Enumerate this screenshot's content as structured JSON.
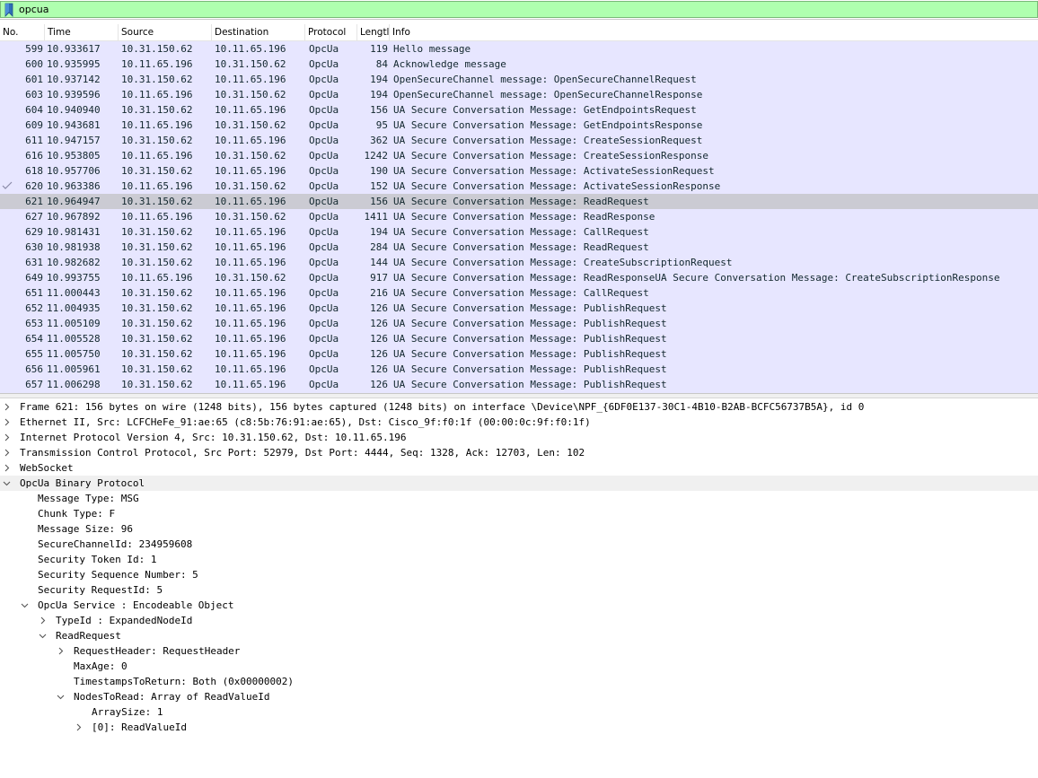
{
  "filter": {
    "value": "opcua",
    "bookmark_icon": "bookmark-icon"
  },
  "columns": {
    "no": "No.",
    "time": "Time",
    "source": "Source",
    "destination": "Destination",
    "protocol": "Protocol",
    "length": "Lengtl",
    "info": "Info"
  },
  "packets": [
    {
      "no": "599",
      "time": "10.933617",
      "source": "10.31.150.62",
      "destination": "10.11.65.196",
      "protocol": "OpcUa",
      "length": "119",
      "info": "Hello message"
    },
    {
      "no": "600",
      "time": "10.935995",
      "source": "10.11.65.196",
      "destination": "10.31.150.62",
      "protocol": "OpcUa",
      "length": "84",
      "info": "Acknowledge message"
    },
    {
      "no": "601",
      "time": "10.937142",
      "source": "10.31.150.62",
      "destination": "10.11.65.196",
      "protocol": "OpcUa",
      "length": "194",
      "info": "OpenSecureChannel message: OpenSecureChannelRequest"
    },
    {
      "no": "603",
      "time": "10.939596",
      "source": "10.11.65.196",
      "destination": "10.31.150.62",
      "protocol": "OpcUa",
      "length": "194",
      "info": "OpenSecureChannel message: OpenSecureChannelResponse"
    },
    {
      "no": "604",
      "time": "10.940940",
      "source": "10.31.150.62",
      "destination": "10.11.65.196",
      "protocol": "OpcUa",
      "length": "156",
      "info": "UA Secure Conversation Message: GetEndpointsRequest"
    },
    {
      "no": "609",
      "time": "10.943681",
      "source": "10.11.65.196",
      "destination": "10.31.150.62",
      "protocol": "OpcUa",
      "length": "95",
      "info": "UA Secure Conversation Message: GetEndpointsResponse"
    },
    {
      "no": "611",
      "time": "10.947157",
      "source": "10.31.150.62",
      "destination": "10.11.65.196",
      "protocol": "OpcUa",
      "length": "362",
      "info": "UA Secure Conversation Message: CreateSessionRequest"
    },
    {
      "no": "616",
      "time": "10.953805",
      "source": "10.11.65.196",
      "destination": "10.31.150.62",
      "protocol": "OpcUa",
      "length": "1242",
      "info": "UA Secure Conversation Message: CreateSessionResponse"
    },
    {
      "no": "618",
      "time": "10.957706",
      "source": "10.31.150.62",
      "destination": "10.11.65.196",
      "protocol": "OpcUa",
      "length": "190",
      "info": "UA Secure Conversation Message: ActivateSessionRequest"
    },
    {
      "no": "620",
      "time": "10.963386",
      "source": "10.11.65.196",
      "destination": "10.31.150.62",
      "protocol": "OpcUa",
      "length": "152",
      "info": "UA Secure Conversation Message: ActivateSessionResponse"
    },
    {
      "no": "621",
      "time": "10.964947",
      "source": "10.31.150.62",
      "destination": "10.11.65.196",
      "protocol": "OpcUa",
      "length": "156",
      "info": "UA Secure Conversation Message: ReadRequest"
    },
    {
      "no": "627",
      "time": "10.967892",
      "source": "10.11.65.196",
      "destination": "10.31.150.62",
      "protocol": "OpcUa",
      "length": "1411",
      "info": "UA Secure Conversation Message: ReadResponse"
    },
    {
      "no": "629",
      "time": "10.981431",
      "source": "10.31.150.62",
      "destination": "10.11.65.196",
      "protocol": "OpcUa",
      "length": "194",
      "info": "UA Secure Conversation Message: CallRequest"
    },
    {
      "no": "630",
      "time": "10.981938",
      "source": "10.31.150.62",
      "destination": "10.11.65.196",
      "protocol": "OpcUa",
      "length": "284",
      "info": "UA Secure Conversation Message: ReadRequest"
    },
    {
      "no": "631",
      "time": "10.982682",
      "source": "10.31.150.62",
      "destination": "10.11.65.196",
      "protocol": "OpcUa",
      "length": "144",
      "info": "UA Secure Conversation Message: CreateSubscriptionRequest"
    },
    {
      "no": "649",
      "time": "10.993755",
      "source": "10.11.65.196",
      "destination": "10.31.150.62",
      "protocol": "OpcUa",
      "length": "917",
      "info": "UA Secure Conversation Message: ReadResponseUA Secure Conversation Message: CreateSubscriptionResponse"
    },
    {
      "no": "651",
      "time": "11.000443",
      "source": "10.31.150.62",
      "destination": "10.11.65.196",
      "protocol": "OpcUa",
      "length": "216",
      "info": "UA Secure Conversation Message: CallRequest"
    },
    {
      "no": "652",
      "time": "11.004935",
      "source": "10.31.150.62",
      "destination": "10.11.65.196",
      "protocol": "OpcUa",
      "length": "126",
      "info": "UA Secure Conversation Message: PublishRequest"
    },
    {
      "no": "653",
      "time": "11.005109",
      "source": "10.31.150.62",
      "destination": "10.11.65.196",
      "protocol": "OpcUa",
      "length": "126",
      "info": "UA Secure Conversation Message: PublishRequest"
    },
    {
      "no": "654",
      "time": "11.005528",
      "source": "10.31.150.62",
      "destination": "10.11.65.196",
      "protocol": "OpcUa",
      "length": "126",
      "info": "UA Secure Conversation Message: PublishRequest"
    },
    {
      "no": "655",
      "time": "11.005750",
      "source": "10.31.150.62",
      "destination": "10.11.65.196",
      "protocol": "OpcUa",
      "length": "126",
      "info": "UA Secure Conversation Message: PublishRequest"
    },
    {
      "no": "656",
      "time": "11.005961",
      "source": "10.31.150.62",
      "destination": "10.11.65.196",
      "protocol": "OpcUa",
      "length": "126",
      "info": "UA Secure Conversation Message: PublishRequest"
    },
    {
      "no": "657",
      "time": "11.006298",
      "source": "10.31.150.62",
      "destination": "10.11.65.196",
      "protocol": "OpcUa",
      "length": "126",
      "info": "UA Secure Conversation Message: PublishRequest"
    }
  ],
  "selected_packet_no": "621",
  "details": [
    {
      "text": "Frame 621: 156 bytes on wire (1248 bits), 156 bytes captured (1248 bits) on interface \\Device\\NPF_{6DF0E137-30C1-4B10-B2AB-BCFC56737B5A}, id 0",
      "level": 0,
      "expander": "collapsed",
      "section": false
    },
    {
      "text": "Ethernet II, Src: LCFCHeFe_91:ae:65 (c8:5b:76:91:ae:65), Dst: Cisco_9f:f0:1f (00:00:0c:9f:f0:1f)",
      "level": 0,
      "expander": "collapsed",
      "section": false
    },
    {
      "text": "Internet Protocol Version 4, Src: 10.31.150.62, Dst: 10.11.65.196",
      "level": 0,
      "expander": "collapsed",
      "section": false
    },
    {
      "text": "Transmission Control Protocol, Src Port: 52979, Dst Port: 4444, Seq: 1328, Ack: 12703, Len: 102",
      "level": 0,
      "expander": "collapsed",
      "section": false
    },
    {
      "text": "WebSocket",
      "level": 0,
      "expander": "collapsed",
      "section": false
    },
    {
      "text": "OpcUa Binary Protocol",
      "level": 0,
      "expander": "expanded",
      "section": true
    },
    {
      "text": "Message Type: MSG",
      "level": 1,
      "expander": "none",
      "section": false
    },
    {
      "text": "Chunk Type: F",
      "level": 1,
      "expander": "none",
      "section": false
    },
    {
      "text": "Message Size: 96",
      "level": 1,
      "expander": "none",
      "section": false
    },
    {
      "text": "SecureChannelId: 234959608",
      "level": 1,
      "expander": "none",
      "section": false
    },
    {
      "text": "Security Token Id: 1",
      "level": 1,
      "expander": "none",
      "section": false
    },
    {
      "text": "Security Sequence Number: 5",
      "level": 1,
      "expander": "none",
      "section": false
    },
    {
      "text": "Security RequestId: 5",
      "level": 1,
      "expander": "none",
      "section": false
    },
    {
      "text": "OpcUa Service : Encodeable Object",
      "level": 1,
      "expander": "expanded",
      "section": false
    },
    {
      "text": "TypeId : ExpandedNodeId",
      "level": 2,
      "expander": "collapsed",
      "section": false
    },
    {
      "text": "ReadRequest",
      "level": 2,
      "expander": "expanded",
      "section": false
    },
    {
      "text": "RequestHeader: RequestHeader",
      "level": 3,
      "expander": "collapsed",
      "section": false
    },
    {
      "text": "MaxAge: 0",
      "level": 3,
      "expander": "none",
      "section": false
    },
    {
      "text": "TimestampsToReturn: Both (0x00000002)",
      "level": 3,
      "expander": "none",
      "section": false
    },
    {
      "text": "NodesToRead: Array of ReadValueId",
      "level": 3,
      "expander": "expanded",
      "section": false
    },
    {
      "text": "ArraySize: 1",
      "level": 4,
      "expander": "none",
      "section": false
    },
    {
      "text": "[0]: ReadValueId",
      "level": 4,
      "expander": "collapsed",
      "section": false
    }
  ],
  "colors": {
    "filter_bg": "#afffaf",
    "row_bg": "#e7e6ff",
    "row_selected_bg": "#cbcbd3",
    "row_text": "#12272e",
    "section_bg": "#f0f0f0"
  },
  "icons": {
    "collapsed": "chevron-right-icon",
    "expanded": "chevron-down-icon",
    "related_packet": "check-icon"
  }
}
